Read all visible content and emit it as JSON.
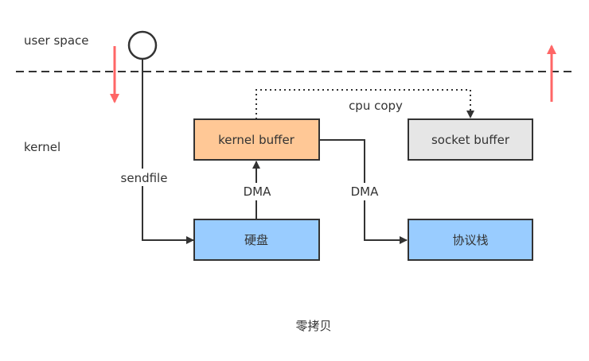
{
  "labels": {
    "user_space": "user space",
    "kernel": "kernel",
    "sendfile": "sendfile",
    "dma_left": "DMA",
    "dma_right": "DMA",
    "cpu_copy": "cpu copy",
    "caption": "零拷贝"
  },
  "boxes": {
    "kernel_buffer": "kernel buffer",
    "socket_buffer": "socket buffer",
    "disk": "硬盘",
    "protocol_stack": "协议栈"
  },
  "colors": {
    "kernel_buffer_fill": "#FFC896",
    "socket_buffer_fill": "#E6E6E6",
    "disk_fill": "#99CCFF",
    "protocol_stack_fill": "#99CCFF",
    "box_stroke": "#333333",
    "red_arrow": "#FF6666"
  }
}
